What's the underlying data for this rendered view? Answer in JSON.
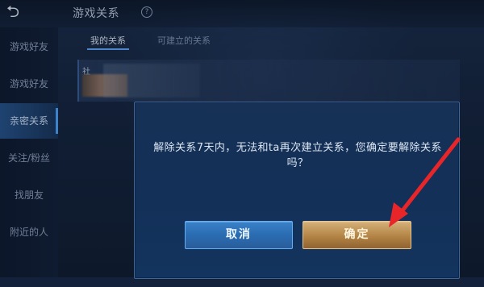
{
  "header": {
    "title": "游戏关系"
  },
  "sidebar": {
    "items": [
      {
        "label": "游戏好友",
        "active": false
      },
      {
        "label": "游戏好友",
        "active": false
      },
      {
        "label": "亲密关系",
        "active": true
      },
      {
        "label": "关注/粉丝",
        "active": false
      },
      {
        "label": "找朋友",
        "active": false
      },
      {
        "label": "附近的人",
        "active": false
      },
      {
        "label": "",
        "active": false
      }
    ]
  },
  "tabs": [
    {
      "label": "我的关系",
      "active": true
    },
    {
      "label": "可建立的关系",
      "active": false
    }
  ],
  "friend": {
    "id_stub": "社"
  },
  "dialog": {
    "message": "解除关系7天内，无法和ta再次建立关系，您确定要解除关系吗？",
    "cancel_label": "取消",
    "confirm_label": "确定"
  },
  "colors": {
    "background": "#13213a",
    "sidebar_active": "#2f67aa",
    "dialog_bg": "#173156",
    "cancel": "#3a82c8",
    "confirm": "#d4b079",
    "arrow": "#e8262a"
  },
  "icons": {
    "back": "back-arrow-icon",
    "help": "help-icon",
    "annotation": "red-arrow"
  }
}
